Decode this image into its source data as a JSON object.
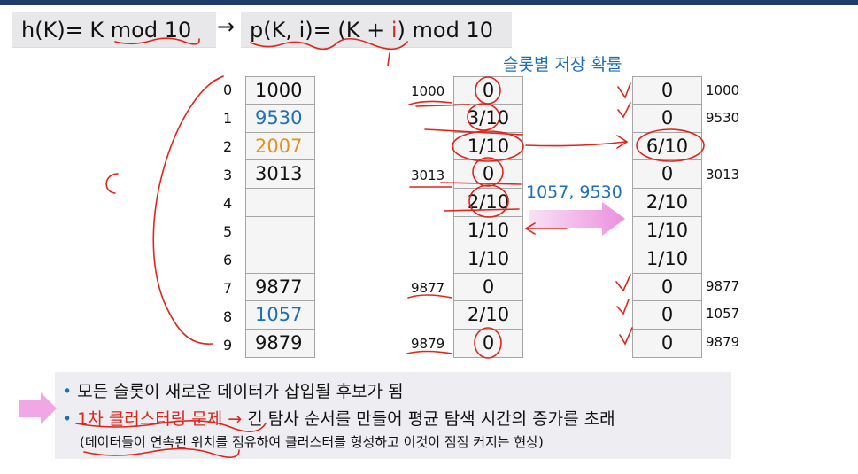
{
  "formula": {
    "hash": "h(K)= K mod 10",
    "arrow": "→",
    "probe_prefix": "p(K, i)= (K + ",
    "probe_i": "i",
    "probe_suffix": ") mod 10"
  },
  "subtitle": "슬롯별 저장 확률",
  "left_table": {
    "indices": [
      "0",
      "1",
      "2",
      "3",
      "4",
      "5",
      "6",
      "7",
      "8",
      "9"
    ],
    "cells": [
      "1000",
      "9530",
      "2007",
      "3013",
      "",
      "",
      "",
      "9877",
      "1057",
      "9879"
    ]
  },
  "mid_table": {
    "cells": [
      "0",
      "3/10",
      "1/10",
      "0",
      "2/10",
      "1/10",
      "1/10",
      "0",
      "2/10",
      "0"
    ],
    "key_labels": [
      {
        "row": 0,
        "text": "1000"
      },
      {
        "row": 3,
        "text": "3013"
      },
      {
        "row": 7,
        "text": "9877"
      },
      {
        "row": 9,
        "text": "9879"
      }
    ]
  },
  "insert_label": "1057, 9530",
  "right_table": {
    "cells": [
      "0",
      "0",
      "6/10",
      "0",
      "2/10",
      "1/10",
      "1/10",
      "0",
      "0",
      "0"
    ],
    "key_labels": [
      {
        "row": 0,
        "text": "1000"
      },
      {
        "row": 1,
        "text": "9530"
      },
      {
        "row": 3,
        "text": "3013"
      },
      {
        "row": 7,
        "text": "9877"
      },
      {
        "row": 8,
        "text": "1057"
      },
      {
        "row": 9,
        "text": "9879"
      }
    ]
  },
  "bullets": {
    "b1": "모든 슬롯이 새로운 데이터가 삽입될 후보가 됨",
    "b2_red": "1차 클러스터링 문제 →",
    "b2_rest": " 긴 탐사 순서를 만들어 평균 탐색 시간의 증가를 초래",
    "note": "(데이터들이 연속된 위치를 점유하여 클러스터를 형성하고  이것이 점점 커지는 현상)"
  },
  "colors": {
    "accent_blue": "#1f6fb6",
    "ink_red": "#d42a20",
    "orange": "#e59122",
    "pink_arrow": "#f1a7e6"
  }
}
